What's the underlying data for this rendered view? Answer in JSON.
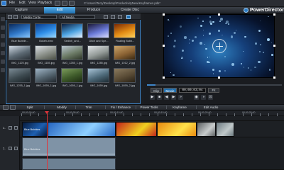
{
  "titlebar": {
    "menus": [
      "File",
      "Edit",
      "View",
      "Playback"
    ],
    "path": "C:\\Users\\Terry\\Desktop\\ProductivityNew\\Keyframes.pds*",
    "brand": "PowerDirector"
  },
  "modes": [
    "Capture",
    "Edit",
    "Produce",
    "Create Disc"
  ],
  "active_mode": "Edit",
  "library": {
    "filter": "Media Conte...",
    "view": "All Media",
    "items": [
      {
        "label": "Blue Bubble...",
        "colors": [
          "#0b2a5a",
          "#2f76c7",
          "#88c7ff"
        ]
      },
      {
        "label": "Bokeh.wmv",
        "colors": [
          "#0a3a8a",
          "#2f8ee8",
          "#9ad8ff"
        ]
      },
      {
        "label": "Sedinh_and...",
        "colors": [
          "#0d2040",
          "#4aa1e0",
          "#e7f3ff"
        ]
      },
      {
        "label": "Ditch and Spe...",
        "colors": [
          "#1c1a3a",
          "#6a7ad8",
          "#d9dcff"
        ]
      },
      {
        "label": "Floating Bubb...",
        "colors": [
          "#7a2a05",
          "#e28b14",
          "#ffd15a"
        ]
      },
      {
        "label": "IMG_1125.jpg",
        "colors": [
          "#cfd9e4",
          "#5d6a74",
          "#2a3036"
        ]
      },
      {
        "label": "IMG_1155.jpg",
        "colors": [
          "#d9dee3",
          "#8a8f88",
          "#4b4f44"
        ]
      },
      {
        "label": "IMG_1285_1.jpg",
        "colors": [
          "#b8c4cf",
          "#6c7b66",
          "#2d3528"
        ]
      },
      {
        "label": "IMG_1285.jpg",
        "colors": [
          "#dfe3e5",
          "#949b98",
          "#3e4442"
        ]
      },
      {
        "label": "IMG_1012_2.jpg",
        "colors": [
          "#c9a46a",
          "#8c6334",
          "#3a2812"
        ]
      },
      {
        "label": "IMG_1255_1.jpg",
        "colors": [
          "#7a8a94",
          "#3d4a50",
          "#1a2226"
        ]
      },
      {
        "label": "IMG_1659_1.jpg",
        "colors": [
          "#9fb4c6",
          "#54646f",
          "#22282e"
        ]
      },
      {
        "label": "IMG_1659_1.jpg",
        "colors": [
          "#7b9b5c",
          "#3e5a2a",
          "#1c2a12"
        ]
      },
      {
        "label": "IMG_1659.jpg",
        "colors": [
          "#a8c3d6",
          "#4e6a7a",
          "#1e2c34"
        ]
      },
      {
        "label": "IMG_1659_2.jpg",
        "colors": [
          "#8a7a5e",
          "#5a4c36",
          "#2a2216"
        ]
      }
    ]
  },
  "preview": {
    "tabs": [
      "Clip",
      "Movie"
    ],
    "active_tab": "Movie",
    "timecode": "00;00;03;04",
    "fps": "Fit",
    "controls": [
      "play-icon",
      "stop-icon",
      "prev-frame-icon",
      "next-frame-icon",
      "fast-forward-icon",
      "snapshot-icon",
      "volume-icon",
      "fullscreen-icon"
    ],
    "control_glyphs": [
      "▶",
      "■",
      "◀",
      "▶",
      "»",
      "◉",
      "◑",
      "⊡"
    ]
  },
  "edit_toolbar": {
    "buttons": [
      "Split",
      "Modify",
      "Trim",
      "Fix / Enhance",
      "Power Tools",
      "Keyframe",
      "Edit Audio"
    ]
  },
  "ruler_labels": [
    "00;00;00;00",
    "00;00;05;00",
    "00;00;10;00",
    "00;00;15;00",
    "00;00;20;00",
    "00;00;25;00"
  ],
  "timeline": {
    "track_numbers": [
      "1.",
      "1."
    ],
    "video_clips": [
      {
        "label": "Blue Bubbles",
        "colors": [
          "#071a3c",
          "#1d5fb0"
        ]
      },
      {
        "label": "",
        "colors": [
          "#2767c2",
          "#8fd0ff"
        ]
      },
      {
        "label": "",
        "colors": [
          "#c2241a",
          "#f0d020"
        ]
      },
      {
        "label": "",
        "colors": [
          "#e88a10",
          "#ffe14a"
        ]
      },
      {
        "label": "",
        "colors": [
          "#5a5e60",
          "#c8cccc"
        ]
      },
      {
        "label": "",
        "colors": [
          "#6c7a80",
          "#c0c8c9"
        ]
      }
    ],
    "audio_clip_label": "Blue Bubbles",
    "playhead_color": "#e0353a"
  }
}
